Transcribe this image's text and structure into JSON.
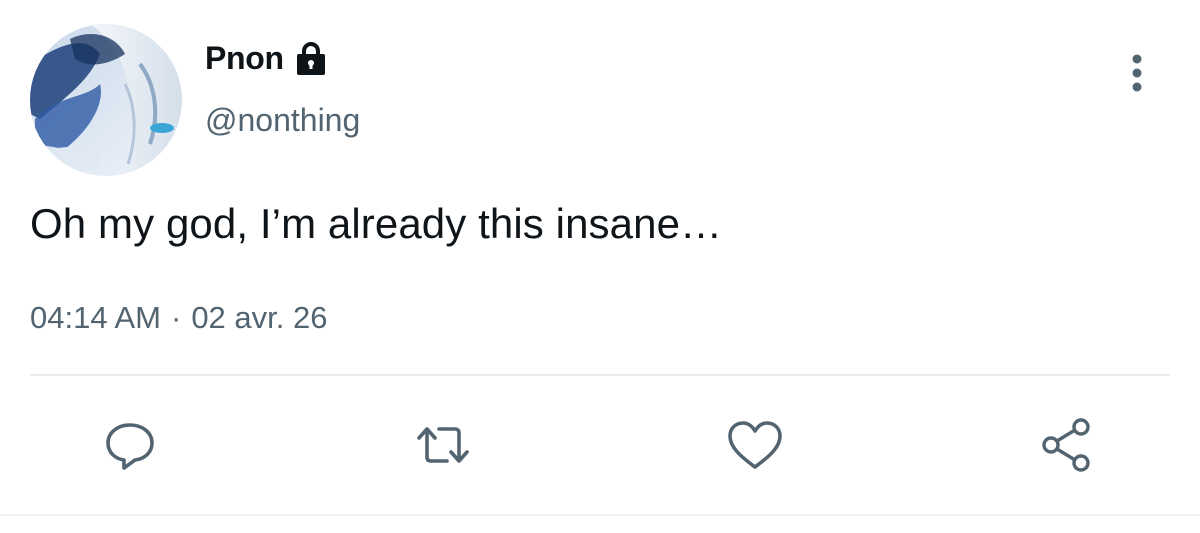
{
  "user": {
    "display_name": "Pnon",
    "handle": "@nonthing",
    "protected": true
  },
  "tweet": {
    "text": "Oh my god, I’m already this insane…",
    "time": "04:14 AM",
    "separator": "·",
    "date": "02 avr. 26"
  },
  "icons": {
    "lock": "lock-icon",
    "more": "more-vertical-icon",
    "reply": "reply-icon",
    "retweet": "retweet-icon",
    "like": "heart-icon",
    "share": "share-icon"
  },
  "colors": {
    "text_primary": "#0f1419",
    "text_secondary": "#536471",
    "icon": "#536471",
    "divider": "#e6ecf0"
  }
}
